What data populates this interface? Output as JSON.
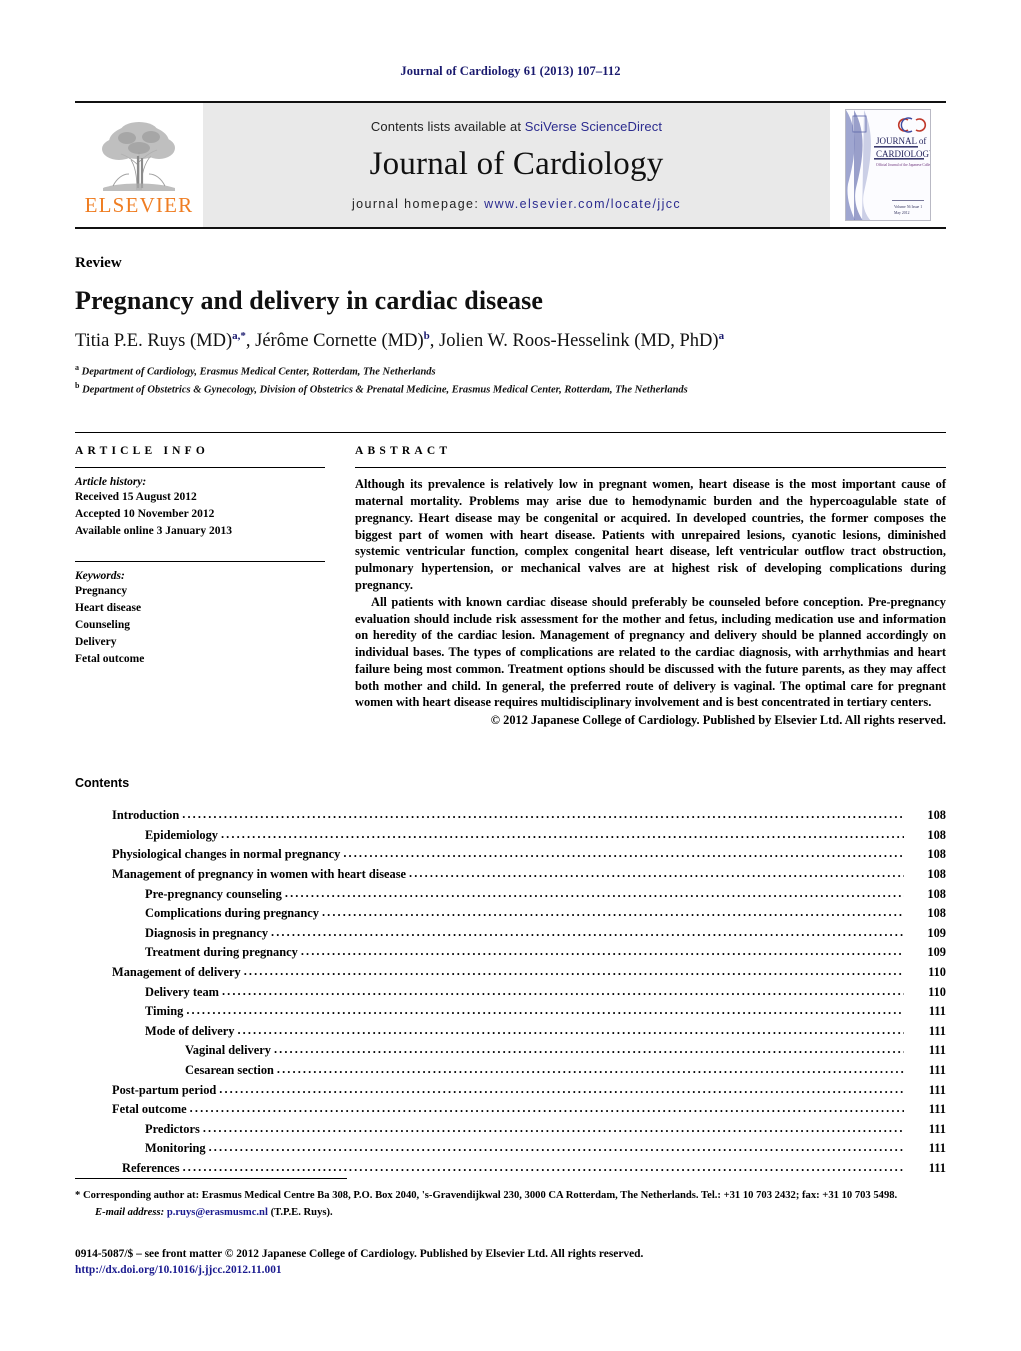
{
  "running_head": "Journal of Cardiology 61 (2013) 107–112",
  "masthead": {
    "publisher_name": "ELSEVIER",
    "contents_prefix": "Contents lists available at ",
    "contents_link": "SciVerse ScienceDirect",
    "journal_title": "Journal of Cardiology",
    "homepage_prefix": "journal homepage: ",
    "homepage_link": "www.elsevier.com/locate/jjcc",
    "cover": {
      "line1": "JOURNAL of",
      "line2": "CARDIOLOGY",
      "tagline": "Official Journal of the Japanese College of Cardiology",
      "volume": "Volume 56 Issue 1",
      "date": "May 2012"
    }
  },
  "article": {
    "kind": "Review",
    "title": "Pregnancy and delivery in cardiac disease",
    "authors": [
      {
        "name": "Titia P.E. Ruys (MD)",
        "marks": "a,*"
      },
      {
        "name": "Jérôme Cornette (MD)",
        "marks": "b"
      },
      {
        "name": "Jolien W. Roos-Hesselink (MD, PhD)",
        "marks": "a"
      }
    ],
    "affiliations": [
      {
        "mark": "a",
        "text": "Department of Cardiology, Erasmus Medical Center, Rotterdam, The Netherlands"
      },
      {
        "mark": "b",
        "text": "Department of Obstetrics & Gynecology, Division of Obstetrics & Prenatal Medicine, Erasmus Medical Center, Rotterdam, The Netherlands"
      }
    ]
  },
  "article_info": {
    "label": "ARTICLE INFO",
    "history_heading": "Article history:",
    "history": [
      "Received 15 August 2012",
      "Accepted 10 November 2012",
      "Available online 3 January 2013"
    ],
    "keywords_heading": "Keywords:",
    "keywords": [
      "Pregnancy",
      "Heart disease",
      "Counseling",
      "Delivery",
      "Fetal outcome"
    ]
  },
  "abstract": {
    "label": "ABSTRACT",
    "paragraphs": [
      "Although its prevalence is relatively low in pregnant women, heart disease is the most important cause of maternal mortality. Problems may arise due to hemodynamic burden and the hypercoagulable state of pregnancy. Heart disease may be congenital or acquired. In developed countries, the former composes the biggest part of women with heart disease. Patients with unrepaired lesions, cyanotic lesions, diminished systemic ventricular function, complex congenital heart disease, left ventricular outflow tract obstruction, pulmonary hypertension, or mechanical valves are at highest risk of developing complications during pregnancy.",
      "All patients with known cardiac disease should preferably be counseled before conception. Pre-pregnancy evaluation should include risk assessment for the mother and fetus, including medication use and information on heredity of the cardiac lesion. Management of pregnancy and delivery should be planned accordingly on individual bases. The types of complications are related to the cardiac diagnosis, with arrhythmias and heart failure being most common. Treatment options should be discussed with the future parents, as they may affect both mother and child. In general, the preferred route of delivery is vaginal. The optimal care for pregnant women with heart disease requires multidisciplinary involvement and is best concentrated in tertiary centers."
    ],
    "copyright": "© 2012 Japanese College of Cardiology. Published by Elsevier Ltd. All rights reserved."
  },
  "contents": {
    "heading": "Contents",
    "entries": [
      {
        "label": "Introduction",
        "page": "108",
        "level": 0
      },
      {
        "label": "Epidemiology",
        "page": "108",
        "level": 1
      },
      {
        "label": "Physiological changes in normal pregnancy",
        "page": "108",
        "level": 0
      },
      {
        "label": "Management of pregnancy in women with heart disease",
        "page": "108",
        "level": 0
      },
      {
        "label": "Pre-pregnancy counseling",
        "page": "108",
        "level": 1
      },
      {
        "label": "Complications during pregnancy",
        "page": "108",
        "level": 1
      },
      {
        "label": "Diagnosis in pregnancy",
        "page": "109",
        "level": 1
      },
      {
        "label": "Treatment during pregnancy",
        "page": "109",
        "level": 1
      },
      {
        "label": "Management of delivery",
        "page": "110",
        "level": 0
      },
      {
        "label": "Delivery team",
        "page": "110",
        "level": 1
      },
      {
        "label": "Timing",
        "page": "111",
        "level": 1
      },
      {
        "label": "Mode of delivery",
        "page": "111",
        "level": 1
      },
      {
        "label": "Vaginal delivery",
        "page": "111",
        "level": 2
      },
      {
        "label": "Cesarean section",
        "page": "111",
        "level": 2
      },
      {
        "label": "Post-partum period",
        "page": "111",
        "level": 0
      },
      {
        "label": "Fetal outcome",
        "page": "111",
        "level": 0
      },
      {
        "label": "Predictors",
        "page": "111",
        "level": 1
      },
      {
        "label": "Monitoring",
        "page": "111",
        "level": 1
      },
      {
        "label": "References",
        "page": "111",
        "level": 3
      }
    ]
  },
  "footnotes": {
    "corresponding": "* Corresponding author at: Erasmus Medical Centre Ba 308, P.O. Box 2040, 's-Gravendijkwal 230, 3000 CA Rotterdam, The Netherlands. Tel.: +31 10 703 2432; fax: +31 10 703 5498.",
    "email_label": "E-mail address:",
    "email": "p.ruys@erasmusmc.nl",
    "email_suffix": "(T.P.E. Ruys).",
    "imprint": "0914-5087/$ – see front matter © 2012 Japanese College of Cardiology. Published by Elsevier Ltd. All rights reserved.",
    "doi": "http://dx.doi.org/10.1016/j.jjcc.2012.11.001"
  }
}
